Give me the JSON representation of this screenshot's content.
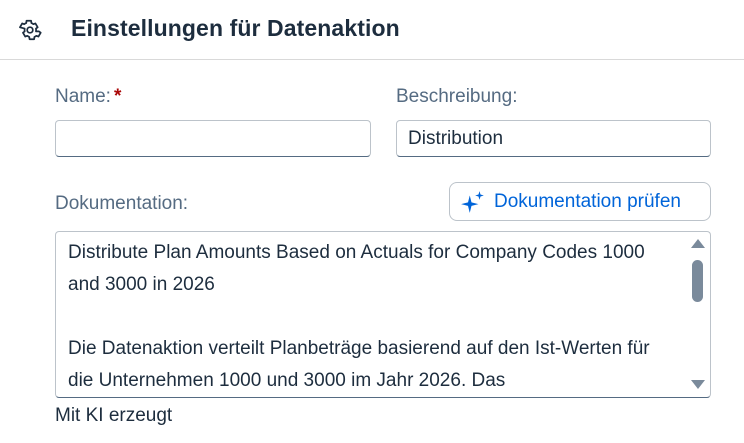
{
  "header": {
    "icon": "gear-icon",
    "title": "Einstellungen für Datenaktion"
  },
  "form": {
    "name_label": "Name:",
    "name_required_marker": "*",
    "name_value": "",
    "description_label": "Beschreibung:",
    "description_value": "Distribution",
    "documentation_label": "Dokumentation:",
    "check_button_label": "Dokumentation prüfen",
    "check_button_icon": "ai-sparkle-icon",
    "documentation_paragraph_1": "Distribute Plan Amounts Based on Actuals for Company Codes 1000 and 3000 in 2026",
    "documentation_paragraph_2": "Die Datenaktion verteilt Planbeträge basierend auf den Ist-Werten für die Unternehmen 1000 und 3000 im Jahr 2026. Das",
    "ai_note": "Mit KI erzeugt"
  },
  "colors": {
    "accent": "#0064d9",
    "required": "#aa0808",
    "label": "#556b82",
    "text": "#1d2d3e"
  }
}
